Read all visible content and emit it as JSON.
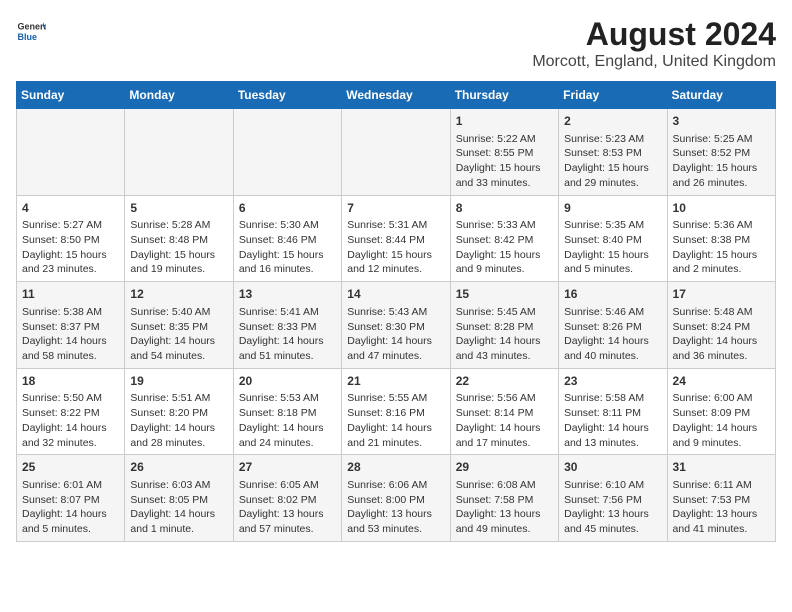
{
  "logo": {
    "general": "General",
    "blue": "Blue"
  },
  "title": "August 2024",
  "subtitle": "Morcott, England, United Kingdom",
  "days_of_week": [
    "Sunday",
    "Monday",
    "Tuesday",
    "Wednesday",
    "Thursday",
    "Friday",
    "Saturday"
  ],
  "weeks": [
    [
      {
        "day": "",
        "info": ""
      },
      {
        "day": "",
        "info": ""
      },
      {
        "day": "",
        "info": ""
      },
      {
        "day": "",
        "info": ""
      },
      {
        "day": "1",
        "info": "Sunrise: 5:22 AM\nSunset: 8:55 PM\nDaylight: 15 hours and 33 minutes."
      },
      {
        "day": "2",
        "info": "Sunrise: 5:23 AM\nSunset: 8:53 PM\nDaylight: 15 hours and 29 minutes."
      },
      {
        "day": "3",
        "info": "Sunrise: 5:25 AM\nSunset: 8:52 PM\nDaylight: 15 hours and 26 minutes."
      }
    ],
    [
      {
        "day": "4",
        "info": "Sunrise: 5:27 AM\nSunset: 8:50 PM\nDaylight: 15 hours and 23 minutes."
      },
      {
        "day": "5",
        "info": "Sunrise: 5:28 AM\nSunset: 8:48 PM\nDaylight: 15 hours and 19 minutes."
      },
      {
        "day": "6",
        "info": "Sunrise: 5:30 AM\nSunset: 8:46 PM\nDaylight: 15 hours and 16 minutes."
      },
      {
        "day": "7",
        "info": "Sunrise: 5:31 AM\nSunset: 8:44 PM\nDaylight: 15 hours and 12 minutes."
      },
      {
        "day": "8",
        "info": "Sunrise: 5:33 AM\nSunset: 8:42 PM\nDaylight: 15 hours and 9 minutes."
      },
      {
        "day": "9",
        "info": "Sunrise: 5:35 AM\nSunset: 8:40 PM\nDaylight: 15 hours and 5 minutes."
      },
      {
        "day": "10",
        "info": "Sunrise: 5:36 AM\nSunset: 8:38 PM\nDaylight: 15 hours and 2 minutes."
      }
    ],
    [
      {
        "day": "11",
        "info": "Sunrise: 5:38 AM\nSunset: 8:37 PM\nDaylight: 14 hours and 58 minutes."
      },
      {
        "day": "12",
        "info": "Sunrise: 5:40 AM\nSunset: 8:35 PM\nDaylight: 14 hours and 54 minutes."
      },
      {
        "day": "13",
        "info": "Sunrise: 5:41 AM\nSunset: 8:33 PM\nDaylight: 14 hours and 51 minutes."
      },
      {
        "day": "14",
        "info": "Sunrise: 5:43 AM\nSunset: 8:30 PM\nDaylight: 14 hours and 47 minutes."
      },
      {
        "day": "15",
        "info": "Sunrise: 5:45 AM\nSunset: 8:28 PM\nDaylight: 14 hours and 43 minutes."
      },
      {
        "day": "16",
        "info": "Sunrise: 5:46 AM\nSunset: 8:26 PM\nDaylight: 14 hours and 40 minutes."
      },
      {
        "day": "17",
        "info": "Sunrise: 5:48 AM\nSunset: 8:24 PM\nDaylight: 14 hours and 36 minutes."
      }
    ],
    [
      {
        "day": "18",
        "info": "Sunrise: 5:50 AM\nSunset: 8:22 PM\nDaylight: 14 hours and 32 minutes."
      },
      {
        "day": "19",
        "info": "Sunrise: 5:51 AM\nSunset: 8:20 PM\nDaylight: 14 hours and 28 minutes."
      },
      {
        "day": "20",
        "info": "Sunrise: 5:53 AM\nSunset: 8:18 PM\nDaylight: 14 hours and 24 minutes."
      },
      {
        "day": "21",
        "info": "Sunrise: 5:55 AM\nSunset: 8:16 PM\nDaylight: 14 hours and 21 minutes."
      },
      {
        "day": "22",
        "info": "Sunrise: 5:56 AM\nSunset: 8:14 PM\nDaylight: 14 hours and 17 minutes."
      },
      {
        "day": "23",
        "info": "Sunrise: 5:58 AM\nSunset: 8:11 PM\nDaylight: 14 hours and 13 minutes."
      },
      {
        "day": "24",
        "info": "Sunrise: 6:00 AM\nSunset: 8:09 PM\nDaylight: 14 hours and 9 minutes."
      }
    ],
    [
      {
        "day": "25",
        "info": "Sunrise: 6:01 AM\nSunset: 8:07 PM\nDaylight: 14 hours and 5 minutes."
      },
      {
        "day": "26",
        "info": "Sunrise: 6:03 AM\nSunset: 8:05 PM\nDaylight: 14 hours and 1 minute."
      },
      {
        "day": "27",
        "info": "Sunrise: 6:05 AM\nSunset: 8:02 PM\nDaylight: 13 hours and 57 minutes."
      },
      {
        "day": "28",
        "info": "Sunrise: 6:06 AM\nSunset: 8:00 PM\nDaylight: 13 hours and 53 minutes."
      },
      {
        "day": "29",
        "info": "Sunrise: 6:08 AM\nSunset: 7:58 PM\nDaylight: 13 hours and 49 minutes."
      },
      {
        "day": "30",
        "info": "Sunrise: 6:10 AM\nSunset: 7:56 PM\nDaylight: 13 hours and 45 minutes."
      },
      {
        "day": "31",
        "info": "Sunrise: 6:11 AM\nSunset: 7:53 PM\nDaylight: 13 hours and 41 minutes."
      }
    ]
  ]
}
